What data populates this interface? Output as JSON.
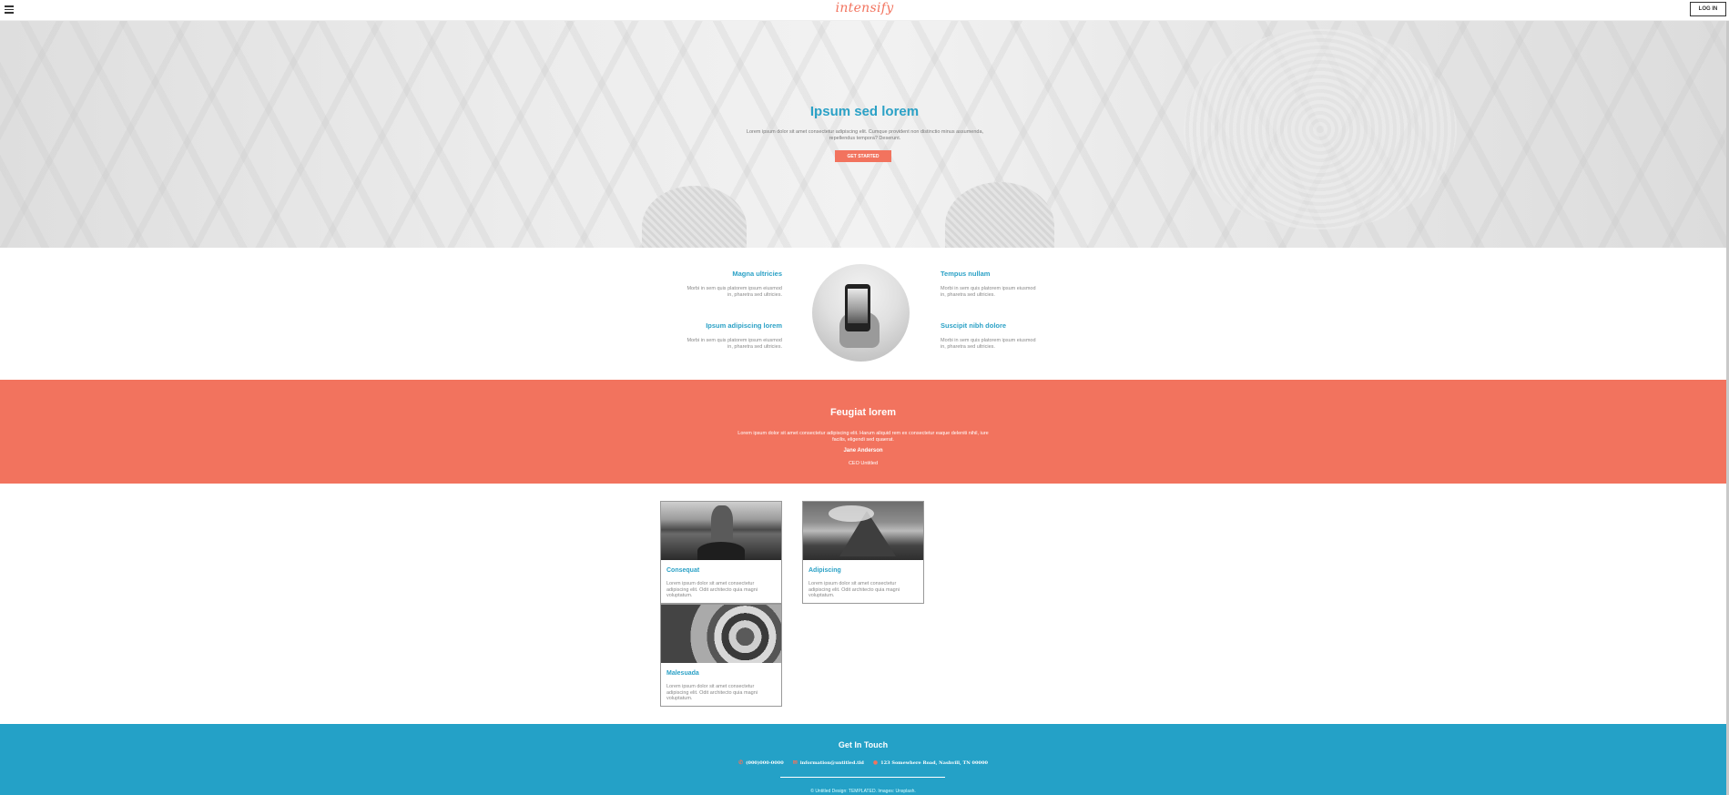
{
  "header": {
    "logo": "intensify",
    "login_label": "LOG IN"
  },
  "hero": {
    "title": "Ipsum sed lorem",
    "text": "Lorem ipsum dolor sit amet consectetur adipiscing elit. Cumque provident non distinctio minus assumenda, repellendus tempora? Deserunt.",
    "button_label": "GET STARTED"
  },
  "features": [
    {
      "title": "Magna ultricies",
      "text": "Morbi in sem quis platorem ipsum eiusmod in, pharetra sed ultricies."
    },
    {
      "title": "Tempus nullam",
      "text": "Morbi in sem quis platorem ipsum eiusmod in, pharetra sed ultricies."
    },
    {
      "title": "Ipsum adipiscing lorem",
      "text": "Morbi in sem quis platorem ipsum eiusmod in, pharetra sed ultricies."
    },
    {
      "title": "Suscipit nibh dolore",
      "text": "Morbi in sem quis platorem ipsum eiusmod in, pharetra sed ultricies."
    }
  ],
  "testimonial": {
    "title": "Feugiat lorem",
    "text": "Lorem ipsum dolor sit amet consectetur adipiscing elit. Harum aliquid rem ex consectetur eaque deleniti nihil, iure facilis, eligendi sed quaerat.",
    "name": "Jane Anderson",
    "role": "CEO Untitled"
  },
  "cards": [
    {
      "title": "Consequat",
      "text": "Lorem ipsum dolor sit amet consectetur adipiscing elit. Odit architecto quia magni voluptatum."
    },
    {
      "title": "Adipiscing",
      "text": "Lorem ipsum dolor sit amet consectetur adipiscing elit. Odit architecto quia magni voluptatum."
    },
    {
      "title": "Malesuada",
      "text": "Lorem ipsum dolor sit amet consectetur adipiscing elit. Odit architecto quia magni voluptatum."
    }
  ],
  "footer": {
    "title": "Get In Touch",
    "phone": "(000)000-0000",
    "email": "information@untitled.tld",
    "address": "123 Somewhere Road, Nashvill, TN 00000",
    "copyright": "© Untitled Design: TEMPLATED. Images: Unsplash."
  },
  "colors": {
    "accent": "#f2735e",
    "primary": "#2ba1c6",
    "footer": "#24a1c7"
  },
  "icons": {
    "menu": "hamburger-menu-icon",
    "phone": "phone-icon",
    "email": "envelope-icon",
    "address": "map-pin-icon"
  }
}
